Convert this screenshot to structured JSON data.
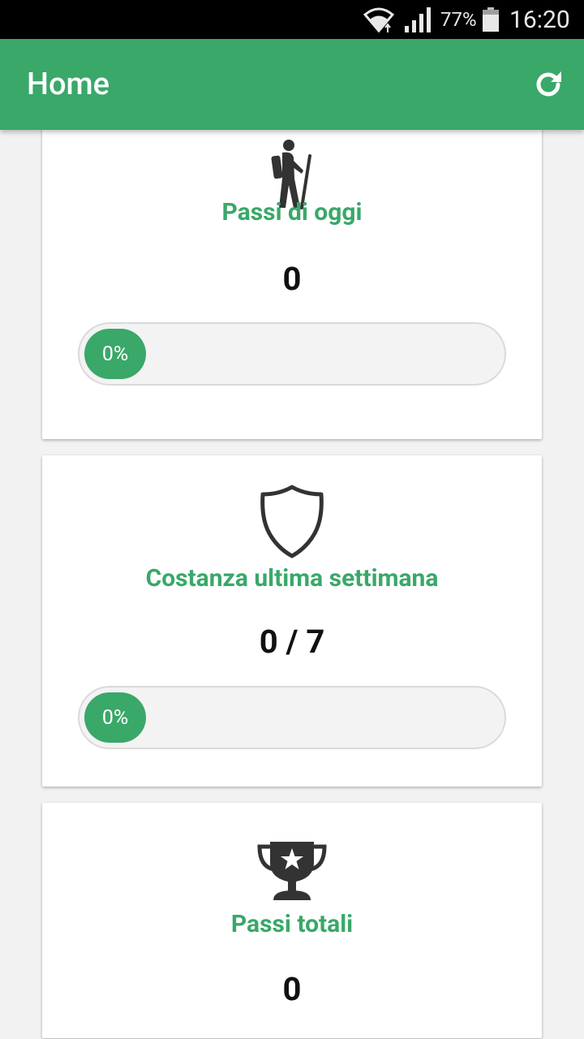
{
  "status_bar": {
    "battery_percent": "77%",
    "time": "16:20",
    "icons": [
      "wifi-icon",
      "signal-icon",
      "battery-icon"
    ]
  },
  "app_bar": {
    "title": "Home",
    "action_icon": "refresh-icon",
    "color": "#39a869"
  },
  "cards": [
    {
      "icon": "hiker-icon",
      "label": "Passi di oggi",
      "value": "0",
      "progress": {
        "percent": 0,
        "label": "0%"
      }
    },
    {
      "icon": "shield-icon",
      "label": "Costanza ultima settimana",
      "value": "0 / 7",
      "progress": {
        "percent": 0,
        "label": "0%"
      }
    },
    {
      "icon": "trophy-icon",
      "label": "Passi totali",
      "value": "0"
    }
  ]
}
